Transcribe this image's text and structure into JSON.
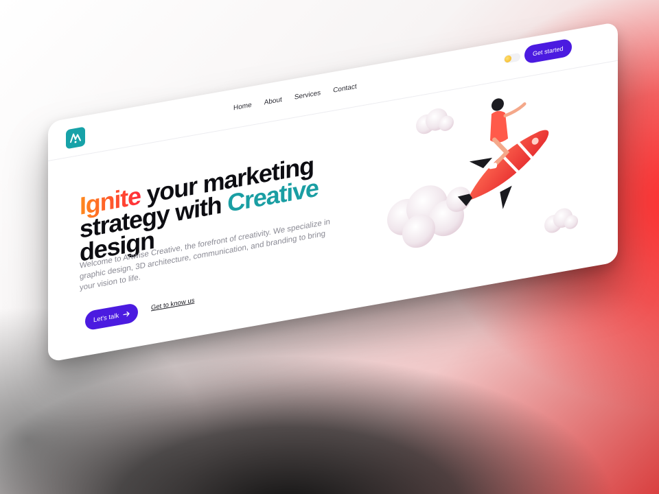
{
  "header": {
    "nav": [
      "Home",
      "About",
      "Services",
      "Contact"
    ],
    "cta": "Get started"
  },
  "hero": {
    "headline_ignite": "Ignite",
    "headline_middle": " your marketing strategy with ",
    "headline_creative": "Creative",
    "headline_end": " design",
    "description": "Welcome to Artwise Creative, the forefront of creativity. We specialize in graphic design, 3D architecture, communication, and branding to bring your vision to life.",
    "primary_cta": "Let's talk",
    "secondary_cta": "Get to know us"
  },
  "colors": {
    "accent": "#4b1be0",
    "teal": "#1a9ea3",
    "gradient_start": "#ff8a1c",
    "gradient_end": "#ff2a3a"
  },
  "icons": {
    "logo": "artwise-logo-icon",
    "theme_toggle": "sun-toggle-icon",
    "cta_arrow": "arrow-right-icon"
  }
}
